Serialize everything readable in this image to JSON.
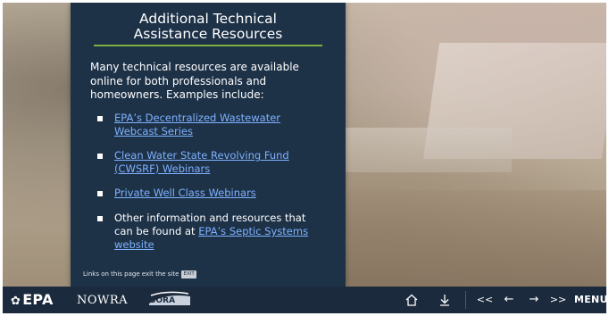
{
  "slide": {
    "title_line1": "Additional Technical",
    "title_line2": "Assistance Resources",
    "intro": "Many technical resources are available online for both professionals and homeowners. Examples include:",
    "items": [
      {
        "link": "EPA’s Decentralized Wastewater Webcast Series"
      },
      {
        "link": "Clean Water State Revolving Fund (CWSRF) Webinars"
      },
      {
        "link": "Private Well Class Webinars"
      },
      {
        "text": "Other information and resources that can be found at ",
        "link": "EPA’s Septic Systems website"
      }
    ],
    "exit_note": "Links on this page exit the site",
    "exit_badge": "EXIT"
  },
  "colors": {
    "panel": "#1d3147",
    "title_rule": "#7bb043",
    "link": "#7fb2ff",
    "navbar": "#1b2a3d"
  },
  "navbar": {
    "logo_epa": "EPA",
    "logo_epa_icon": "epa-flower-icon",
    "logo_nowra": "NOWRA",
    "logo_sora": "SORA",
    "home_icon": "home-icon",
    "download_icon": "download-icon",
    "first_label": "<<",
    "prev_label": "←",
    "next_label": "→",
    "last_label": ">>",
    "menu_label": "MENU"
  }
}
